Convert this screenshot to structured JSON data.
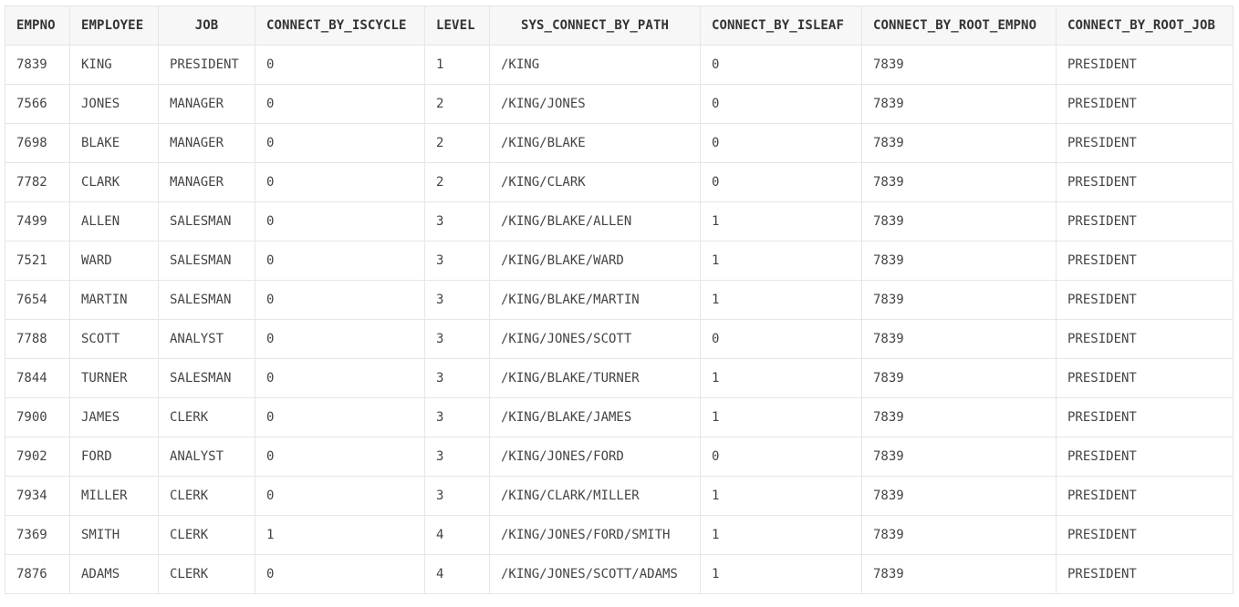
{
  "table": {
    "columns": [
      {
        "key": "empno",
        "label": "EMPNO",
        "center": false
      },
      {
        "key": "employee",
        "label": "EMPLOYEE",
        "center": false
      },
      {
        "key": "job",
        "label": "JOB",
        "center": true
      },
      {
        "key": "connect_by_iscycle",
        "label": "CONNECT_BY_ISCYCLE",
        "center": false
      },
      {
        "key": "level",
        "label": "LEVEL",
        "center": false
      },
      {
        "key": "sys_connect_by_path",
        "label": "SYS_CONNECT_BY_PATH",
        "center": true
      },
      {
        "key": "connect_by_isleaf",
        "label": "CONNECT_BY_ISLEAF",
        "center": false
      },
      {
        "key": "connect_by_root_empno",
        "label": "CONNECT_BY_ROOT_EMPNO",
        "center": false
      },
      {
        "key": "connect_by_root_job",
        "label": "CONNECT_BY_ROOT_JOB",
        "center": false
      }
    ],
    "rows": [
      [
        "7839",
        "KING",
        "PRESIDENT",
        "0",
        "1",
        "/KING",
        "0",
        "7839",
        "PRESIDENT"
      ],
      [
        "7566",
        "JONES",
        "MANAGER",
        "0",
        "2",
        "/KING/JONES",
        "0",
        "7839",
        "PRESIDENT"
      ],
      [
        "7698",
        "BLAKE",
        "MANAGER",
        "0",
        "2",
        "/KING/BLAKE",
        "0",
        "7839",
        "PRESIDENT"
      ],
      [
        "7782",
        "CLARK",
        "MANAGER",
        "0",
        "2",
        "/KING/CLARK",
        "0",
        "7839",
        "PRESIDENT"
      ],
      [
        "7499",
        "ALLEN",
        "SALESMAN",
        "0",
        "3",
        "/KING/BLAKE/ALLEN",
        "1",
        "7839",
        "PRESIDENT"
      ],
      [
        "7521",
        "WARD",
        "SALESMAN",
        "0",
        "3",
        "/KING/BLAKE/WARD",
        "1",
        "7839",
        "PRESIDENT"
      ],
      [
        "7654",
        "MARTIN",
        "SALESMAN",
        "0",
        "3",
        "/KING/BLAKE/MARTIN",
        "1",
        "7839",
        "PRESIDENT"
      ],
      [
        "7788",
        "SCOTT",
        "ANALYST",
        "0",
        "3",
        "/KING/JONES/SCOTT",
        "0",
        "7839",
        "PRESIDENT"
      ],
      [
        "7844",
        "TURNER",
        "SALESMAN",
        "0",
        "3",
        "/KING/BLAKE/TURNER",
        "1",
        "7839",
        "PRESIDENT"
      ],
      [
        "7900",
        "JAMES",
        "CLERK",
        "0",
        "3",
        "/KING/BLAKE/JAMES",
        "1",
        "7839",
        "PRESIDENT"
      ],
      [
        "7902",
        "FORD",
        "ANALYST",
        "0",
        "3",
        "/KING/JONES/FORD",
        "0",
        "7839",
        "PRESIDENT"
      ],
      [
        "7934",
        "MILLER",
        "CLERK",
        "0",
        "3",
        "/KING/CLARK/MILLER",
        "1",
        "7839",
        "PRESIDENT"
      ],
      [
        "7369",
        "SMITH",
        "CLERK",
        "1",
        "4",
        "/KING/JONES/FORD/SMITH",
        "1",
        "7839",
        "PRESIDENT"
      ],
      [
        "7876",
        "ADAMS",
        "CLERK",
        "0",
        "4",
        "/KING/JONES/SCOTT/ADAMS",
        "1",
        "7839",
        "PRESIDENT"
      ]
    ]
  }
}
